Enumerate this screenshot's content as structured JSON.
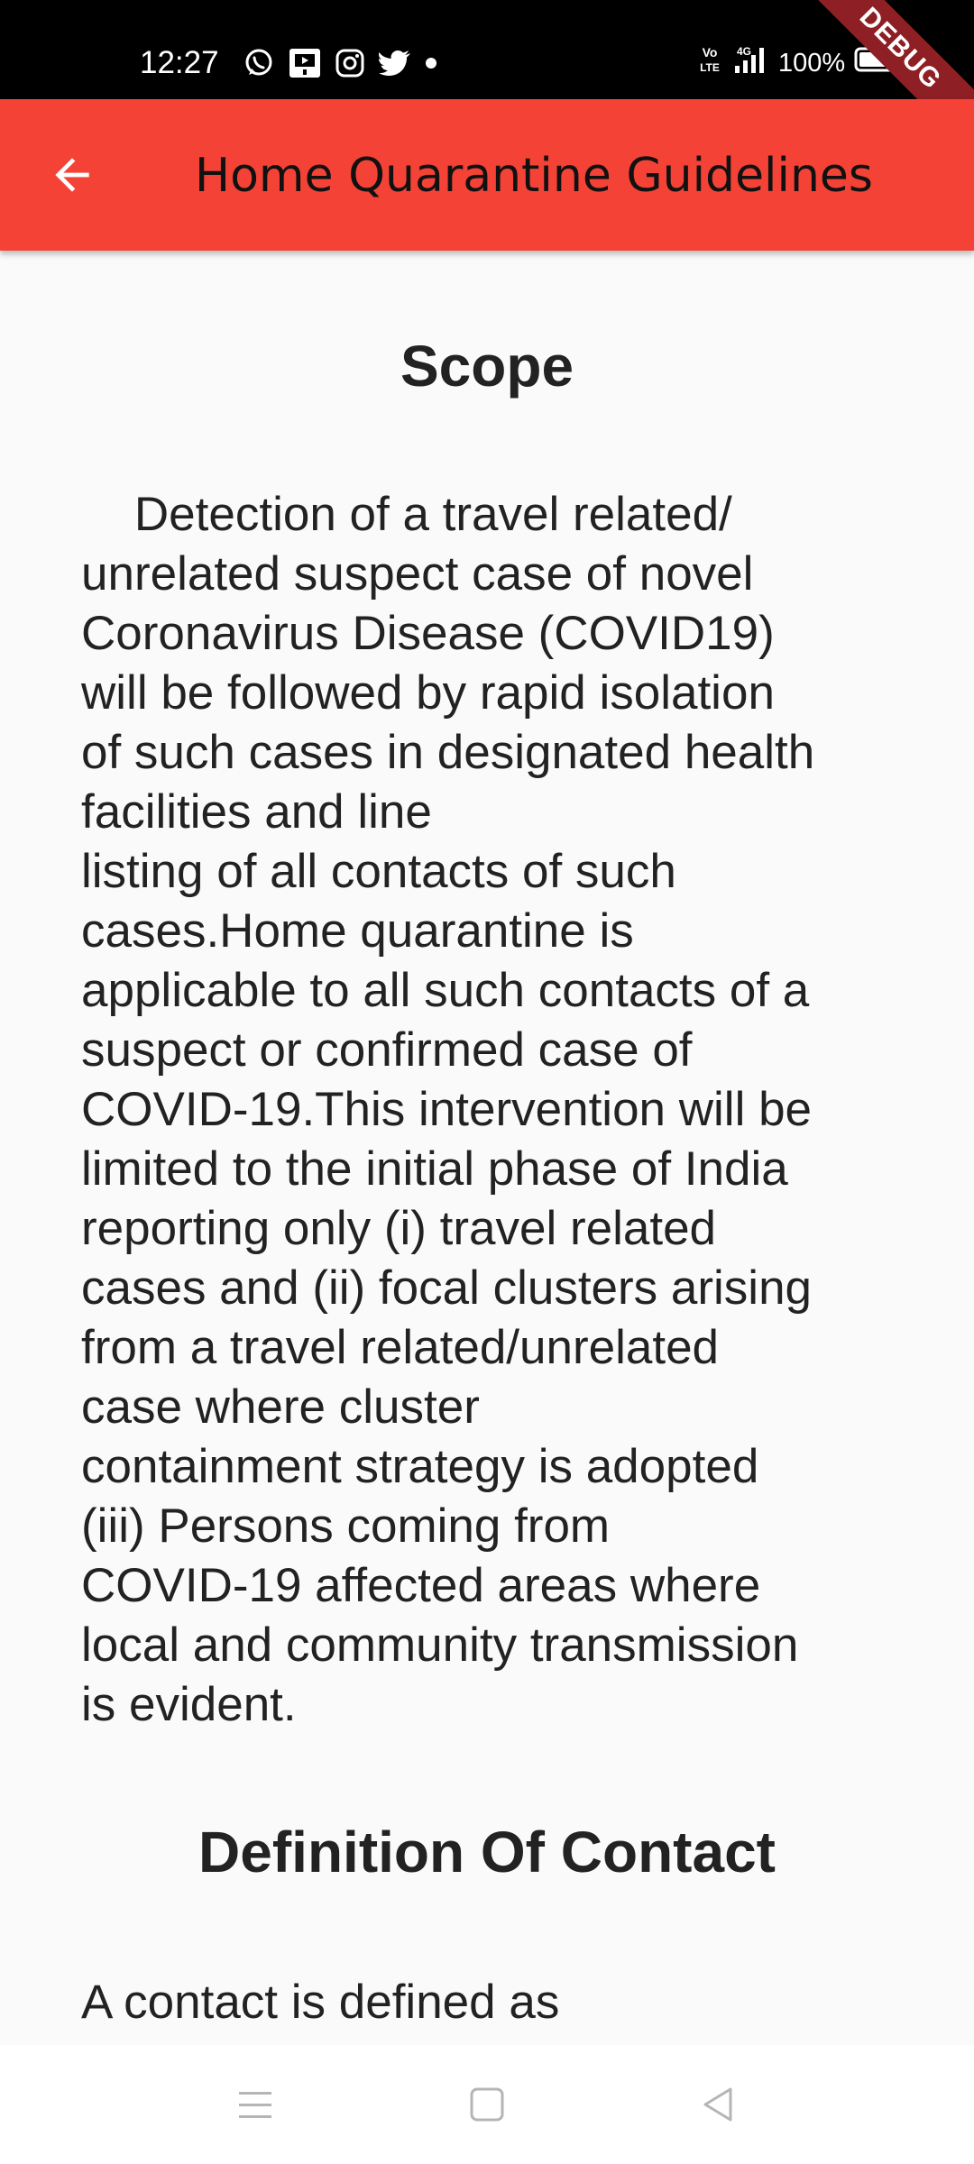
{
  "status_bar": {
    "time": "12:27",
    "notification_icons": [
      "whatsapp-icon",
      "youtube-studio-icon",
      "instagram-icon",
      "twitter-icon",
      "dot-icon"
    ],
    "network_label": "VoLTE",
    "network_type": "4G",
    "battery": "100%",
    "debug_label": "DEBUG"
  },
  "app_bar": {
    "title": "Home Quarantine Guidelines",
    "background_color": "#f44336",
    "back_icon": "arrow-back-icon"
  },
  "sections": [
    {
      "heading": "Scope",
      "body": "    Detection of a travel related/\nunrelated suspect case of novel\nCoronavirus Disease (COVID19)\nwill be followed by rapid isolation\nof such cases in designated health\nfacilities and line\nlisting of all contacts of such\ncases.Home quarantine is\napplicable to all such contacts of a\nsuspect or confirmed case of\nCOVID-19.This intervention will be\nlimited to the initial phase of India\nreporting only (i) travel related\ncases and (ii) focal clusters arising\nfrom a travel related/unrelated\ncase where cluster\ncontainment strategy is adopted\n(iii) Persons coming from\nCOVID-19 affected areas where\nlocal and community transmission\nis evident."
    },
    {
      "heading": "Definition Of Contact",
      "body": "A contact is defined as"
    }
  ],
  "nav_bar": {
    "icons": [
      "menu-icon",
      "home-icon",
      "back-icon"
    ]
  }
}
